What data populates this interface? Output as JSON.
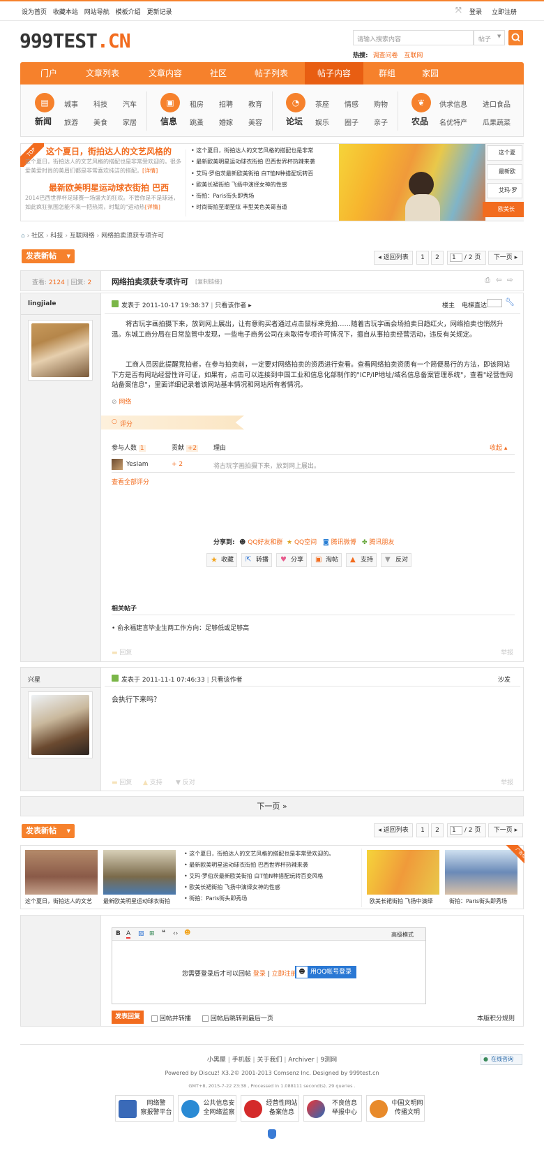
{
  "topbar": {
    "set_home": "设为首页",
    "bookmark": "收藏本站",
    "nav_map": "网站导航",
    "template_intro": "模板介绍",
    "update_log": "更新记录",
    "login": "登录",
    "register": "立即注册"
  },
  "logo": {
    "main": "999TEST",
    "ext": ".CN"
  },
  "search": {
    "placeholder": "请输入搜索内容",
    "type": "帖子",
    "hot_label": "热搜:",
    "hot1": "调查问卷",
    "hot2": "互联网"
  },
  "nav": [
    "门户",
    "文章列表",
    "文章内容",
    "社区",
    "帖子列表",
    "帖子内容",
    "群组",
    "家园"
  ],
  "subnav": {
    "g1": {
      "big": "新闻",
      "items": [
        "城事",
        "科技",
        "汽车",
        "旅游",
        "美食",
        "家居"
      ]
    },
    "g2": {
      "big": "信息",
      "items": [
        "租房",
        "招聘",
        "教育",
        "跳蚤",
        "婚嫁",
        "美容"
      ]
    },
    "g3": {
      "big": "论坛",
      "items": [
        "茶座",
        "情感",
        "购物",
        "娱乐",
        "圈子",
        "亲子"
      ]
    },
    "g4": {
      "big": "农品",
      "items": [
        "供求信息",
        "进口食品",
        "名优特产",
        "瓜果蔬菜"
      ]
    }
  },
  "banner": {
    "top_tag": "TOP",
    "h1": "这个夏日，街拍达人的文艺风格的",
    "p1": "这个夏日，街拍达人的文艺风格的搭配也是非常受欢迎的。很多爱美爱时尚的美眉们都是非常喜欢纯洁的搭配，",
    "more1": "[详情]",
    "h2": "最新欧美明星运动球衣街拍 巴西",
    "p2": "2014巴西世界杯足球赛一场盛大的狂欢。不管你是不是球迷，如此疯狂氛围怎能不来一把热闹，时髦的\"运动热",
    "more2": "[详情]",
    "list": [
      "这个夏日，街拍达人的文艺风格的搭配也是非常",
      "最新欧美明星运动球衣街拍 巴西世界杯热辣来袭",
      "艾玛·罗伯茨最新欧美街拍 白T恤N种搭配玩转百",
      "欧美长裙街拍 飞扬中演绎女神的性感",
      "街拍：Paris街头即秀场",
      "时尚街拍至潮至炫 丰型美色美哥当道"
    ],
    "tabs": [
      "这个夏",
      "最新欧",
      "艾玛·罗",
      "欧美长"
    ]
  },
  "breadcrumb": [
    "社区",
    "科技",
    "互联网络",
    "网络拍卖须获专项许可"
  ],
  "toolbar": {
    "new_post": "发表新帖",
    "back": "返回列表",
    "p1": "1",
    "p2": "2",
    "page_input": "1",
    "page_total": "/ 2 页",
    "next": "下一页"
  },
  "thread": {
    "views_label": "查看:",
    "views": "2124",
    "replies_label": "回复:",
    "replies": "2",
    "title": "网络拍卖须获专项许可",
    "copy_link": "[复制链接]"
  },
  "post1": {
    "author": "lingjiale",
    "posted": "发表于 2011-10-17 19:38:37",
    "only_author": "只看该作者",
    "floor": "楼主",
    "jump": "电梯直达",
    "p1": "将古玩字画拍摄下来，放到网上展出，让有意购买者通过点击鼠标来竞拍……随着古玩字画会场拍卖日趋红火，网络拍卖也悄然升温。东城工商分局在日常监管中发现，一些电子商务公司在未取得专项许可情况下，擅自从事拍卖经营活动，违反有关规定。",
    "p2": "工商人员因此提醒竞拍者，在参与拍卖前，一定要对网络拍卖的资质进行查看。查看网络拍卖资质有一个简便易行的方法，即该网站下方是否有网站经营性许可证，如果有，点击可以连接到中国工业和信息化部制作的\"ICP/IP地址/域名信息备案管理系统\"，查看\"经营性网站备案信息\"，里面详细记录着该网站基本情况和网站所有者情况。",
    "tag": "网络",
    "rate": "评分",
    "rate_cols": {
      "people": "参与人数",
      "people_n": "1",
      "contrib": "贡献",
      "contrib_n": "+2",
      "reason": "理由",
      "collapse": "收起"
    },
    "rate_row": {
      "user": "YesIam",
      "val": "+ 2",
      "reason": "将古玩字画拍摄下来，放到网上展出。"
    },
    "view_all": "查看全部评分",
    "share_to": "分享到:",
    "share": [
      "QQ好友和群",
      "QQ空间",
      "腾讯微博",
      "腾讯朋友"
    ],
    "actions": [
      "收藏",
      "转播",
      "分享",
      "淘帖",
      "支持",
      "反对"
    ],
    "related_title": "相关帖子",
    "related": "• 俞永福建言毕业生两工作方向：足够低或足够高",
    "reply": "回复",
    "report": "举报"
  },
  "post2": {
    "author": "兴星",
    "posted": "发表于 2011-11-1 07:46:33",
    "only_author": "只看该作者",
    "floor": "沙发",
    "body": "会执行下来吗？",
    "reply": "回复",
    "support": "支持",
    "oppose": "反对",
    "report": "举报"
  },
  "next_page": "下一页  »",
  "bottom_banner": {
    "cap1": "这个夏日，街拍达人的文艺",
    "cap2": "最新欧美明星运动球衣街拍",
    "list": [
      "这个夏日，街拍达人的文艺风格的搭配也是非常受欢迎的。",
      "最新欧美明星运动球衣街拍 巴西世界杯热辣来袭",
      "艾玛·罗伯茨最新欧美街拍 白T恤N种搭配玩转百变风格",
      "欧美长裙街拍 飞扬中演绎女神的性感",
      "街拍：Paris街头即秀场"
    ],
    "cap3": "欧美长裙街拍 飞扬中演绎",
    "cap4": "街拍：Paris街头即秀场",
    "ad": "广告位"
  },
  "editor": {
    "advanced": "高级模式",
    "login_msg": "您需要登录后才可以回帖",
    "login": "登录",
    "register": "立即注册",
    "qq_login": "用QQ帐号登录",
    "submit": "发表回复",
    "opt1": "回帖并转播",
    "opt2": "回帖后跳转到最后一页",
    "rules": "本版积分规则"
  },
  "footer": {
    "links": [
      "小黑屋",
      "手机版",
      "关于我们",
      "Archiver",
      "9测网"
    ],
    "online": "在线咨询",
    "powered": "Powered by Discuz! X3.2© 2001-2013 Comsenz Inc. Designed by 999test.cn",
    "gmt": "GMT+8, 2015-7-22 23:38 , Processed in 1.088111 second(s), 29 queries .",
    "badges": [
      [
        "网络警",
        "察报警平台"
      ],
      [
        "公共信息安",
        "全网络监察"
      ],
      [
        "经营性网站",
        "备案信息"
      ],
      [
        "不良信息",
        "举报中心"
      ],
      [
        "中国文明网",
        "传播文明"
      ]
    ]
  }
}
